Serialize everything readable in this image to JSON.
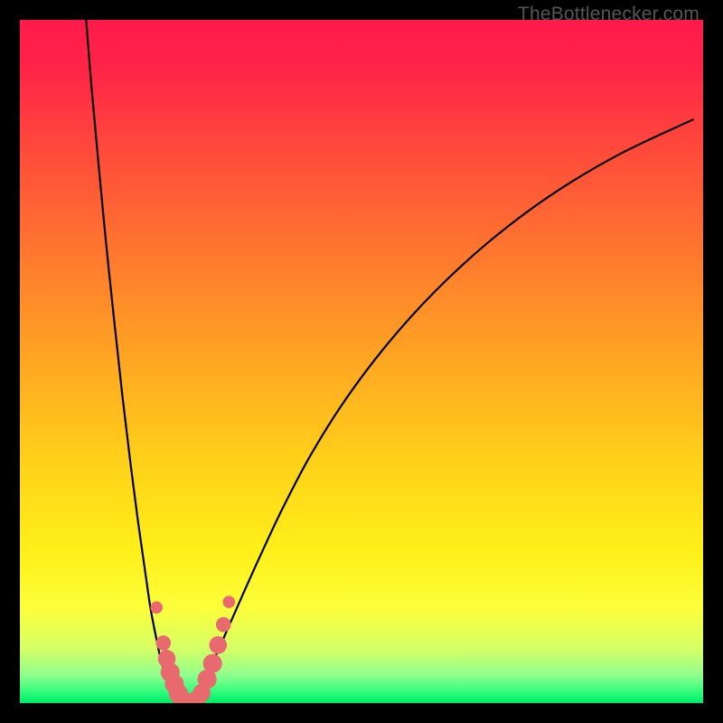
{
  "watermark": "TheBottlenecker.com",
  "gradient": {
    "stops": [
      {
        "offset": 0.0,
        "color": "#ff1a4a"
      },
      {
        "offset": 0.07,
        "color": "#ff2448"
      },
      {
        "offset": 0.2,
        "color": "#ff4d3a"
      },
      {
        "offset": 0.35,
        "color": "#ff7a2e"
      },
      {
        "offset": 0.5,
        "color": "#ffa722"
      },
      {
        "offset": 0.65,
        "color": "#ffd219"
      },
      {
        "offset": 0.78,
        "color": "#fff01a"
      },
      {
        "offset": 0.86,
        "color": "#fcff3a"
      },
      {
        "offset": 0.92,
        "color": "#d6ff66"
      },
      {
        "offset": 0.96,
        "color": "#8dff8d"
      },
      {
        "offset": 0.985,
        "color": "#2bfc7a"
      },
      {
        "offset": 1.0,
        "color": "#00e868"
      }
    ]
  },
  "chart_data": {
    "type": "line",
    "title": "",
    "xlabel": "",
    "ylabel": "",
    "x_range": [
      0,
      100
    ],
    "y_range": [
      0,
      100
    ],
    "series": [
      {
        "name": "left-curve",
        "x": [
          9.7,
          10.5,
          11.5,
          12.6,
          13.8,
          15.0,
          16.2,
          17.3,
          18.3,
          19.1,
          19.9,
          20.6,
          21.3,
          21.9,
          22.5,
          23.0,
          23.5,
          24.0
        ],
        "y": [
          100.0,
          90.0,
          79.0,
          67.5,
          56.0,
          45.0,
          35.0,
          26.5,
          19.5,
          14.0,
          9.8,
          6.5,
          4.2,
          2.6,
          1.5,
          0.8,
          0.3,
          0.0
        ]
      },
      {
        "name": "right-curve",
        "x": [
          24.0,
          24.8,
          25.8,
          27.0,
          28.5,
          30.3,
          32.5,
          35.2,
          38.5,
          42.5,
          47.5,
          53.5,
          60.5,
          68.5,
          77.5,
          87.5,
          98.5
        ],
        "y": [
          0.0,
          0.5,
          1.6,
          3.6,
          6.6,
          10.6,
          15.6,
          21.6,
          28.6,
          36.2,
          44.2,
          52.2,
          60.0,
          67.4,
          74.2,
          80.2,
          85.4
        ]
      }
    ],
    "markers": [
      {
        "series": "left-curve",
        "x": 20.0,
        "y": 14.0,
        "r": 0.9
      },
      {
        "series": "left-curve",
        "x": 21.0,
        "y": 8.8,
        "r": 1.1
      },
      {
        "series": "left-curve",
        "x": 21.5,
        "y": 6.5,
        "r": 1.3
      },
      {
        "series": "left-curve",
        "x": 22.0,
        "y": 4.5,
        "r": 1.4
      },
      {
        "series": "left-curve",
        "x": 22.6,
        "y": 2.8,
        "r": 1.4
      },
      {
        "series": "left-curve",
        "x": 23.2,
        "y": 1.4,
        "r": 1.4
      },
      {
        "series": "left-curve",
        "x": 23.7,
        "y": 0.6,
        "r": 1.3
      },
      {
        "series": "left-curve",
        "x": 24.4,
        "y": 0.2,
        "r": 1.3
      },
      {
        "series": "left-curve",
        "x": 25.1,
        "y": 0.2,
        "r": 1.3
      },
      {
        "series": "right-curve",
        "x": 25.8,
        "y": 0.4,
        "r": 1.3
      },
      {
        "series": "right-curve",
        "x": 26.6,
        "y": 1.5,
        "r": 1.3
      },
      {
        "series": "right-curve",
        "x": 27.4,
        "y": 3.5,
        "r": 1.4
      },
      {
        "series": "right-curve",
        "x": 28.2,
        "y": 5.8,
        "r": 1.4
      },
      {
        "series": "right-curve",
        "x": 29.0,
        "y": 8.5,
        "r": 1.3
      },
      {
        "series": "right-curve",
        "x": 29.8,
        "y": 11.5,
        "r": 1.1
      },
      {
        "series": "right-curve",
        "x": 30.6,
        "y": 14.8,
        "r": 0.9
      }
    ],
    "marker_color": "#e86a6f"
  }
}
